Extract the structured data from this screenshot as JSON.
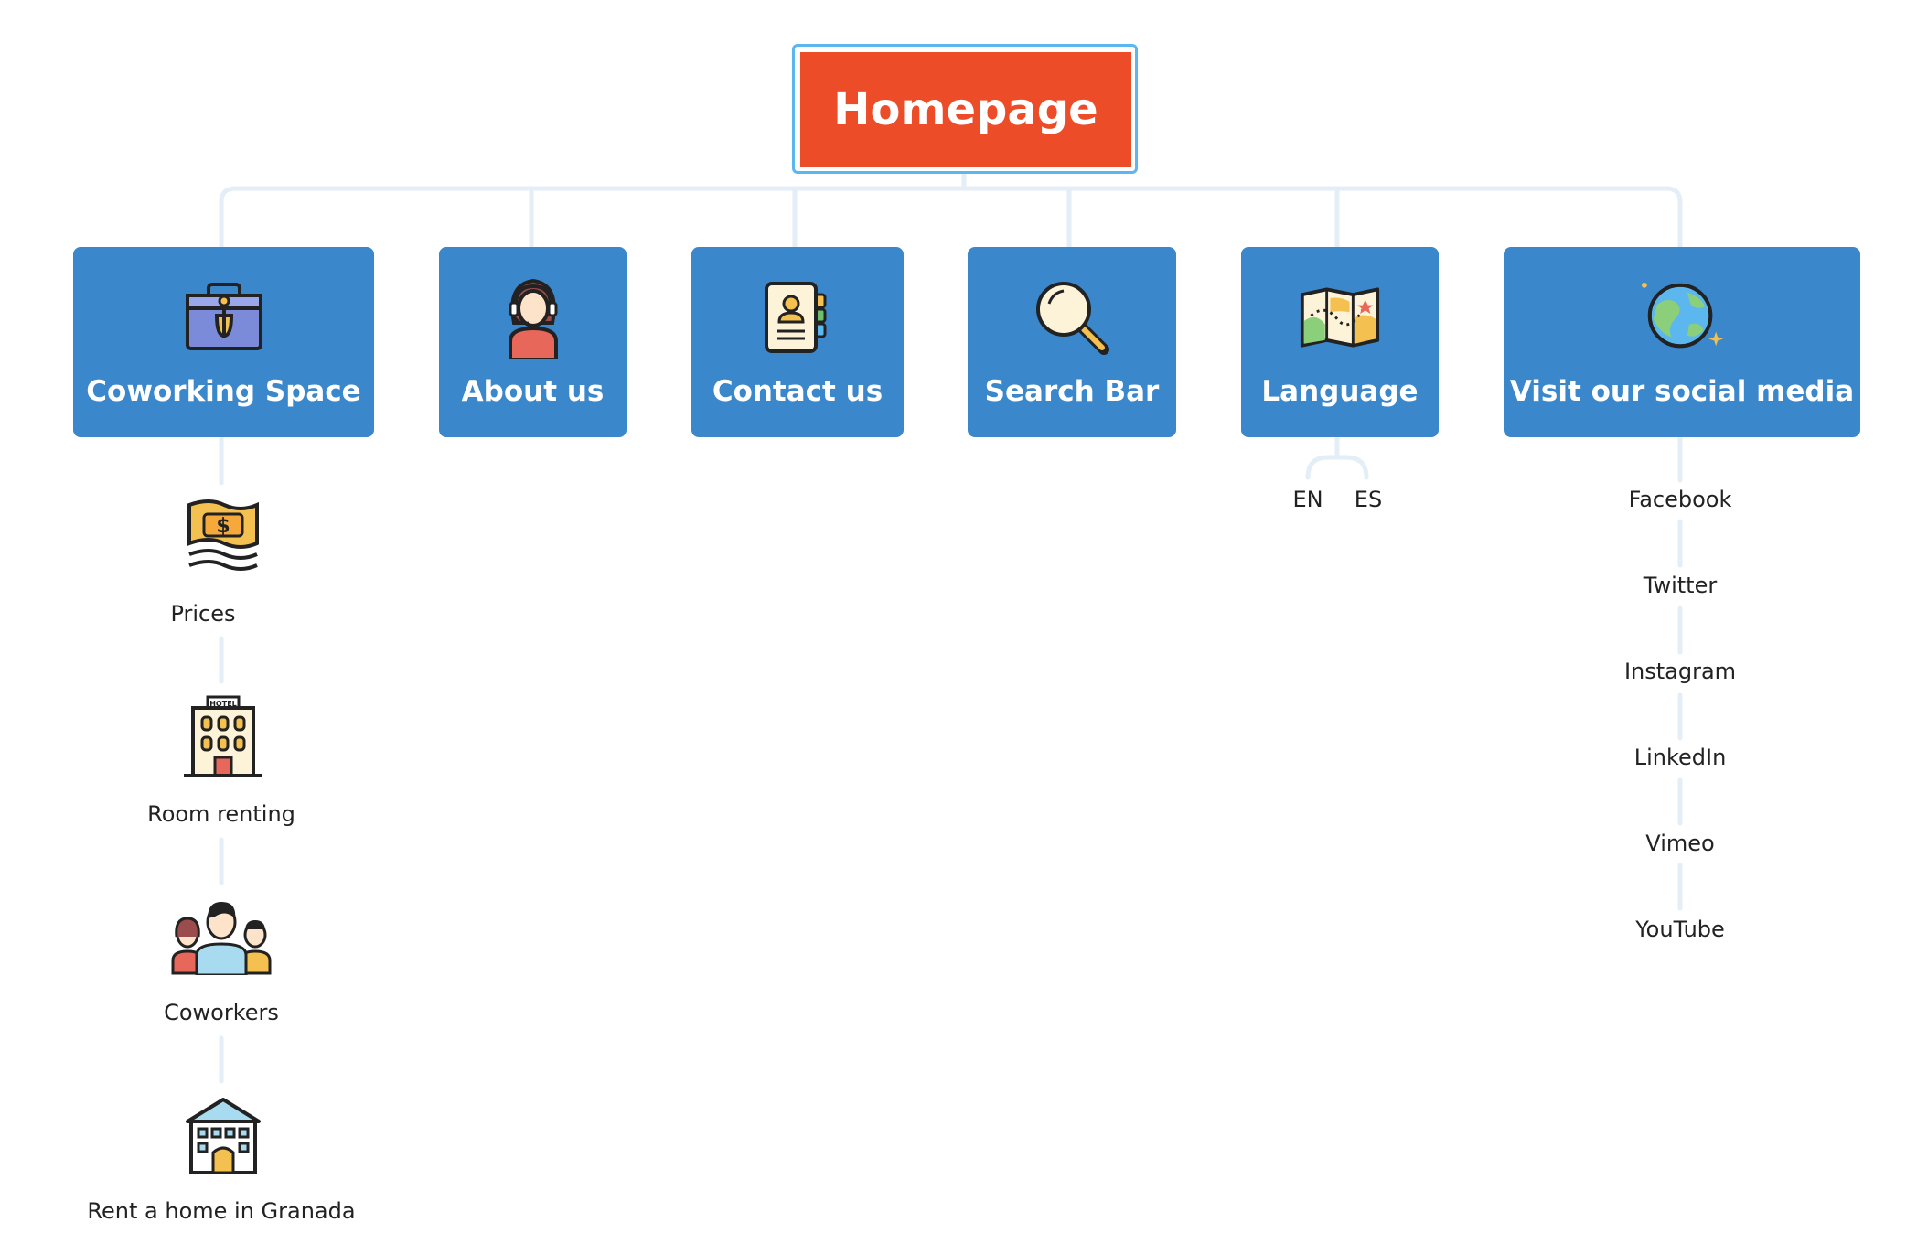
{
  "root": {
    "label": "Homepage"
  },
  "topics": [
    {
      "label": "Coworking Space",
      "icon": "briefcase-icon"
    },
    {
      "label": "About us",
      "icon": "support-agent-icon"
    },
    {
      "label": "Contact us",
      "icon": "contact-card-icon"
    },
    {
      "label": "Search Bar",
      "icon": "magnifier-icon"
    },
    {
      "label": "Language",
      "icon": "map-icon"
    },
    {
      "label": "Visit our social media",
      "icon": "globe-icon"
    }
  ],
  "coworking_children": [
    {
      "label": "Prices",
      "icon": "money-icon"
    },
    {
      "label": "Room renting",
      "icon": "hotel-icon",
      "icon_text": "HOTEL"
    },
    {
      "label": "Coworkers",
      "icon": "people-icon"
    },
    {
      "label": "Rent a home in Granada",
      "icon": "house-icon"
    }
  ],
  "language_children": [
    "EN",
    "ES"
  ],
  "social_children": [
    "Facebook",
    "Twitter",
    "Instagram",
    "LinkedIn",
    "Vimeo",
    "YouTube"
  ],
  "colors": {
    "root": "#ec4c27",
    "root_frame": "#5cb7ee",
    "topic": "#3a87cc",
    "connector": "#e4eef6"
  }
}
